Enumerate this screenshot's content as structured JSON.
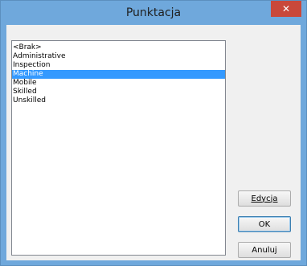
{
  "window": {
    "title": "Punktacja",
    "close_glyph": "✕"
  },
  "list": {
    "items": [
      "<Brak>",
      "Administrative",
      "Inspection",
      "Machine",
      "Mobile",
      "Skilled",
      "Unskilled"
    ],
    "selected_index": 3
  },
  "buttons": {
    "edit_label": "Edycja",
    "ok_label": "OK",
    "cancel_label": "Anuluj"
  },
  "colors": {
    "titlebar": "#6fa8dc",
    "close_button": "#c9483a",
    "selection": "#3399ff"
  }
}
